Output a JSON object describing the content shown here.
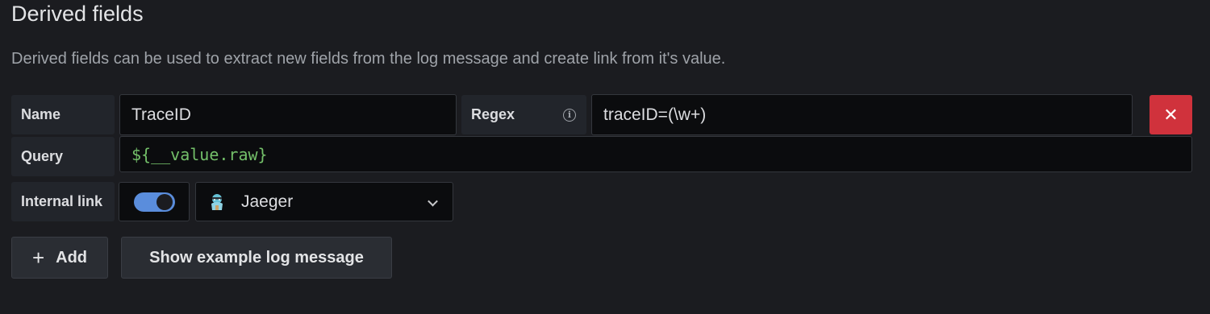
{
  "section": {
    "title": "Derived fields",
    "description": "Derived fields can be used to extract new fields from the log message and create link from it's value."
  },
  "field": {
    "name_label": "Name",
    "name_value": "TraceID",
    "regex_label": "Regex",
    "regex_info_icon": "info-icon",
    "regex_value": "traceID=(\\w+)",
    "delete_icon": "close-icon",
    "delete_glyph": "✕",
    "query_label": "Query",
    "query_value": "${__value.raw}",
    "internal_link_label": "Internal link",
    "internal_link_enabled": true,
    "datasource_icon": "jaeger-icon",
    "datasource_name": "Jaeger"
  },
  "actions": {
    "add_icon": "plus-icon",
    "add_glyph": "+",
    "add_label": "Add",
    "show_example_label": "Show example log message"
  },
  "colors": {
    "background": "#1b1c20",
    "delete": "#d0323c",
    "toggle_on": "#5a8ddc",
    "query_text": "#73bf69"
  }
}
